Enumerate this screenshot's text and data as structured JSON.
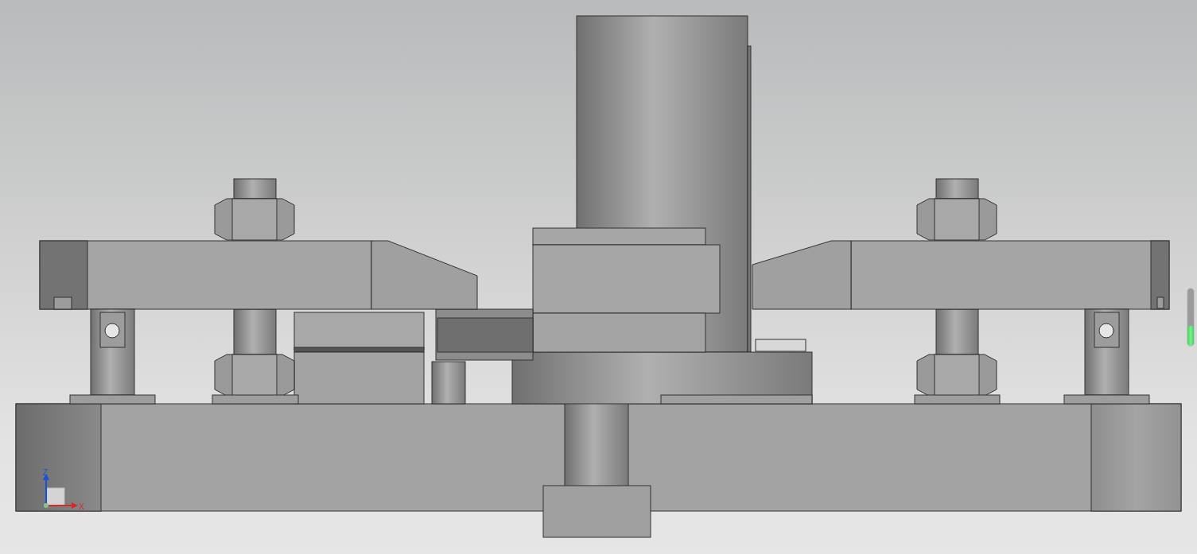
{
  "viewport": {
    "axis_triad": {
      "labels": [
        "Z",
        "X"
      ]
    },
    "indicator": {
      "level": 0.35
    }
  }
}
